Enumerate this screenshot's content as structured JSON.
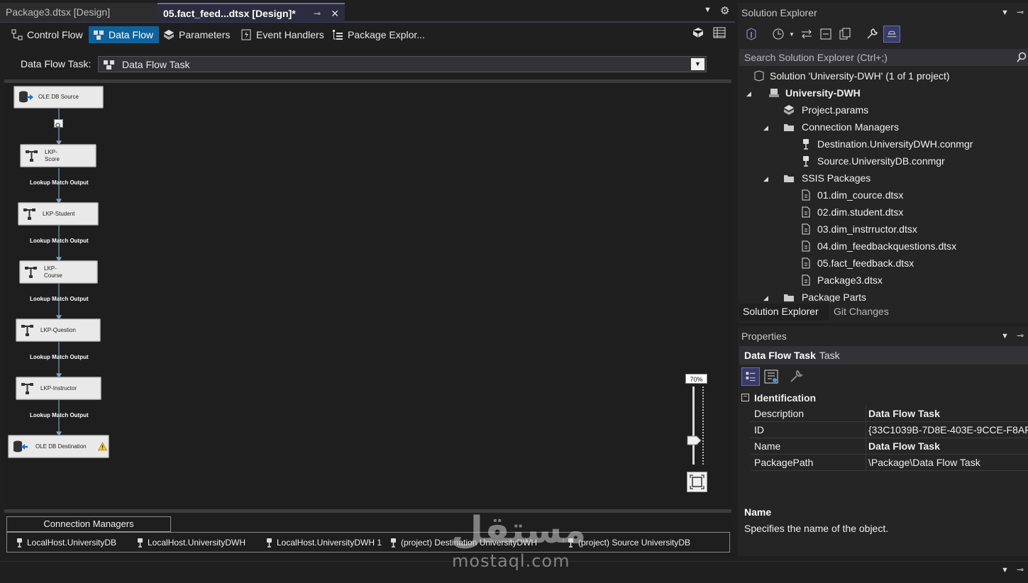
{
  "tabs": [
    {
      "label": "Package3.dtsx [Design]"
    },
    {
      "label": "05.fact_feed...dtsx [Design]*"
    }
  ],
  "designer_tabs": [
    {
      "label": "Control Flow"
    },
    {
      "label": "Data Flow"
    },
    {
      "label": "Parameters"
    },
    {
      "label": "Event Handlers"
    },
    {
      "label": "Package Explor..."
    }
  ],
  "task": {
    "label": "Data Flow Task:",
    "value": "Data Flow Task"
  },
  "flow": {
    "nodes": [
      {
        "label": "OLE DB Source"
      },
      {
        "label": "LKP-\nScore"
      },
      {
        "label": "LKP-Student"
      },
      {
        "label": "LKP-\nCourse"
      },
      {
        "label": "LKP-Question"
      },
      {
        "label": "LKP-Instructor"
      },
      {
        "label": "OLE DB Destination"
      }
    ],
    "path_label": "Lookup Match Output"
  },
  "zoom": {
    "level": "70%",
    "fraction": 0.7
  },
  "connection_managers": {
    "tab_label": "Connection Managers",
    "items": [
      {
        "label": "LocalHost.UniversityDB"
      },
      {
        "label": "LocalHost.UniversityDWH"
      },
      {
        "label": "LocalHost.UniversityDWH 1"
      },
      {
        "label": "(project) Destination UniversityDWH"
      },
      {
        "label": "(project) Source UniversityDB"
      }
    ]
  },
  "solution_explorer": {
    "title": "Solution Explorer",
    "search_placeholder": "Search Solution Explorer (Ctrl+;)",
    "solution": "Solution 'University-DWH' (1 of 1 project)",
    "project": "University-DWH",
    "params": "Project.params",
    "conn_folder": "Connection Managers",
    "conns": [
      "Destination.UniversityDWH.conmgr",
      "Source.UniversityDB.conmgr"
    ],
    "pkg_folder": "SSIS Packages",
    "packages": [
      "01.dim_cource.dtsx",
      "02.dim.student.dtsx",
      "03.dim_instrructor.dtsx",
      "04.dim_feedbackquestions.dtsx",
      "05.fact_feedback.dtsx",
      "Package3.dtsx"
    ],
    "parts_folder": "Package Parts",
    "bottom_tabs": [
      "Solution Explorer",
      "Git Changes"
    ]
  },
  "properties": {
    "title": "Properties",
    "object_name": "Data Flow Task",
    "object_type": "Task",
    "category": "Identification",
    "rows": [
      {
        "key": "Description",
        "value": "Data Flow Task"
      },
      {
        "key": "ID",
        "value": "{33C1039B-7D8E-403E-9CCE-F8AF"
      },
      {
        "key": "Name",
        "value": "Data Flow Task"
      },
      {
        "key": "PackagePath",
        "value": "\\Package\\Data Flow Task"
      }
    ],
    "desc_title": "Name",
    "desc_text": "Specifies the name of the object."
  },
  "watermark": {
    "arabic": "مستقل",
    "latin": "mostaql.com"
  }
}
